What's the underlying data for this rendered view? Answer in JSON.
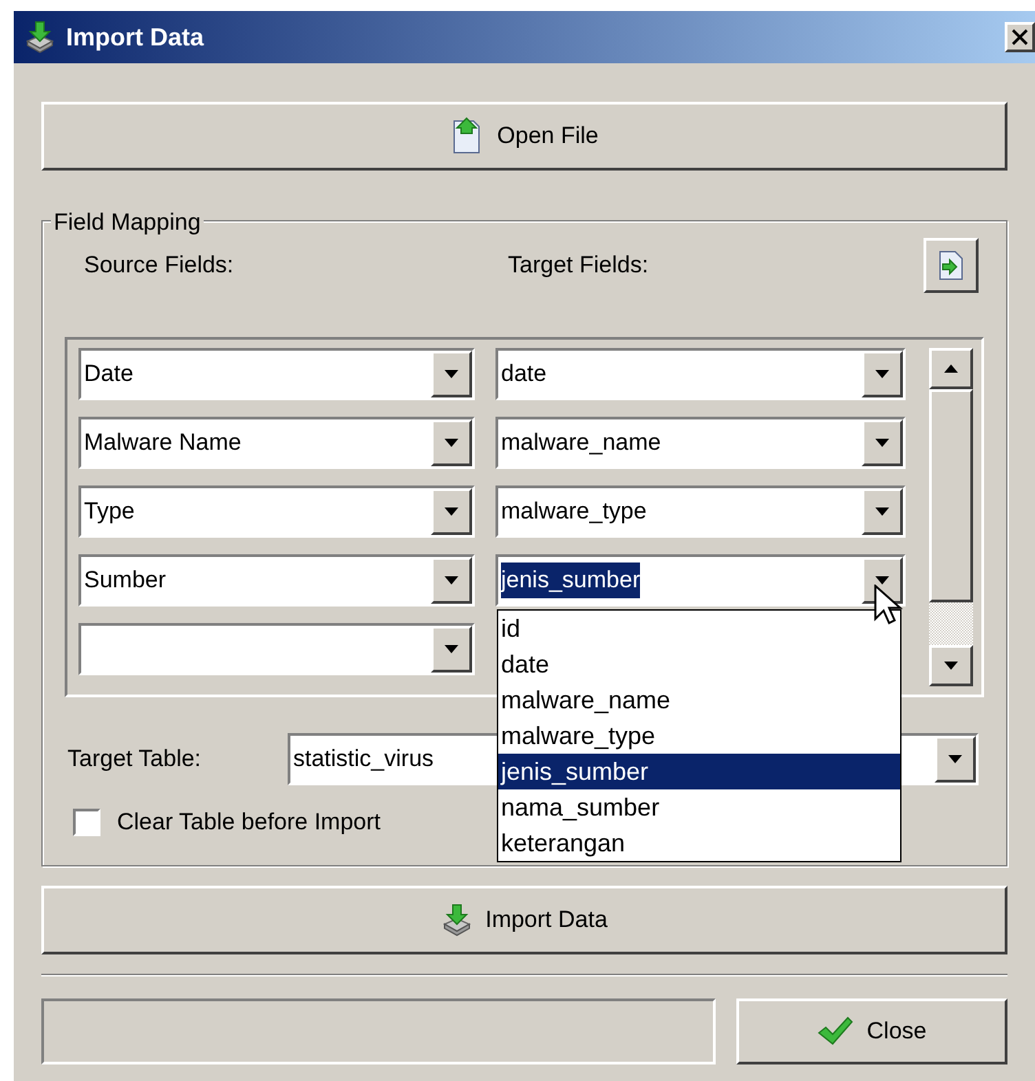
{
  "window": {
    "title": "Import Data"
  },
  "open_file_button": "Open File",
  "field_mapping": {
    "title": "Field Mapping",
    "source_label": "Source Fields:",
    "target_label": "Target Fields:",
    "rows": [
      {
        "kind": "pair",
        "source": "Date",
        "target": "date",
        "highlighted": false
      },
      {
        "kind": "pair",
        "source": "Malware Name",
        "target": "malware_name",
        "highlighted": false
      },
      {
        "kind": "pair",
        "source": "Type",
        "target": "malware_type",
        "highlighted": false
      },
      {
        "kind": "pair",
        "source": "Sumber",
        "target": "jenis_sumber",
        "highlighted": true
      },
      {
        "kind": "blank"
      }
    ],
    "dropdown": [
      {
        "label": "id",
        "selected": false
      },
      {
        "label": "date",
        "selected": false
      },
      {
        "label": "malware_name",
        "selected": false
      },
      {
        "label": "malware_type",
        "selected": false
      },
      {
        "label": "jenis_sumber",
        "selected": true
      },
      {
        "label": "nama_sumber",
        "selected": false
      },
      {
        "label": "keterangan",
        "selected": false
      }
    ],
    "target_table": {
      "label": "Target Table:",
      "value": "statistic_virus"
    },
    "clear_table": {
      "label": "Clear Table before Import",
      "checked": false
    }
  },
  "import_button": "Import Data",
  "close_button": "Close"
}
